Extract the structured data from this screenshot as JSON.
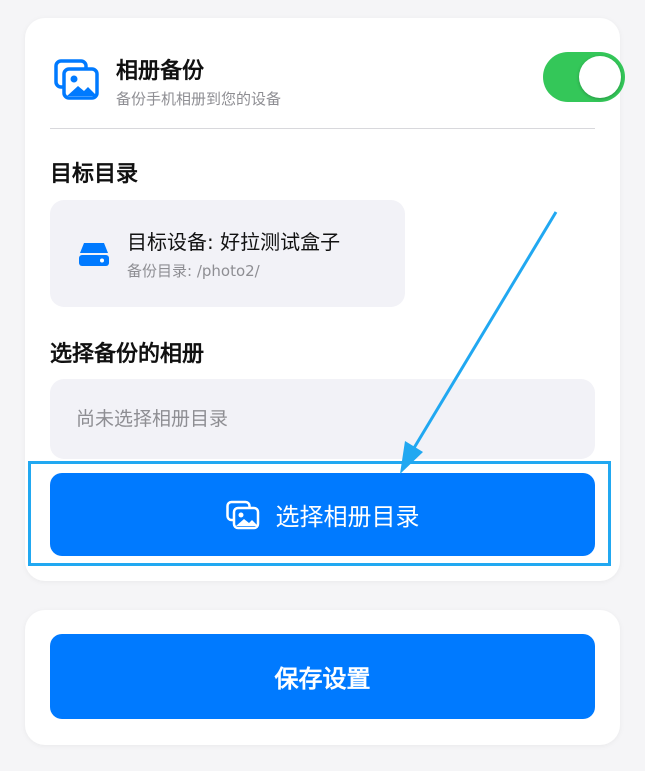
{
  "backup": {
    "title": "相册备份",
    "subtitle": "备份手机相册到您的设备",
    "toggle_enabled": true
  },
  "target": {
    "section_title": "目标目录",
    "device_label": "目标设备: 好拉测试盒子",
    "path_label": "备份目录: /photo2/"
  },
  "albums": {
    "section_title": "选择备份的相册",
    "placeholder": "尚未选择相册目录",
    "select_button_label": "选择相册目录"
  },
  "save_button_label": "保存设置",
  "colors": {
    "accent": "#007aff",
    "toggle_on": "#34c759",
    "highlight": "#21a8f1"
  },
  "icons": [
    "photo-album-icon",
    "disk-icon",
    "photo-album-icon"
  ]
}
